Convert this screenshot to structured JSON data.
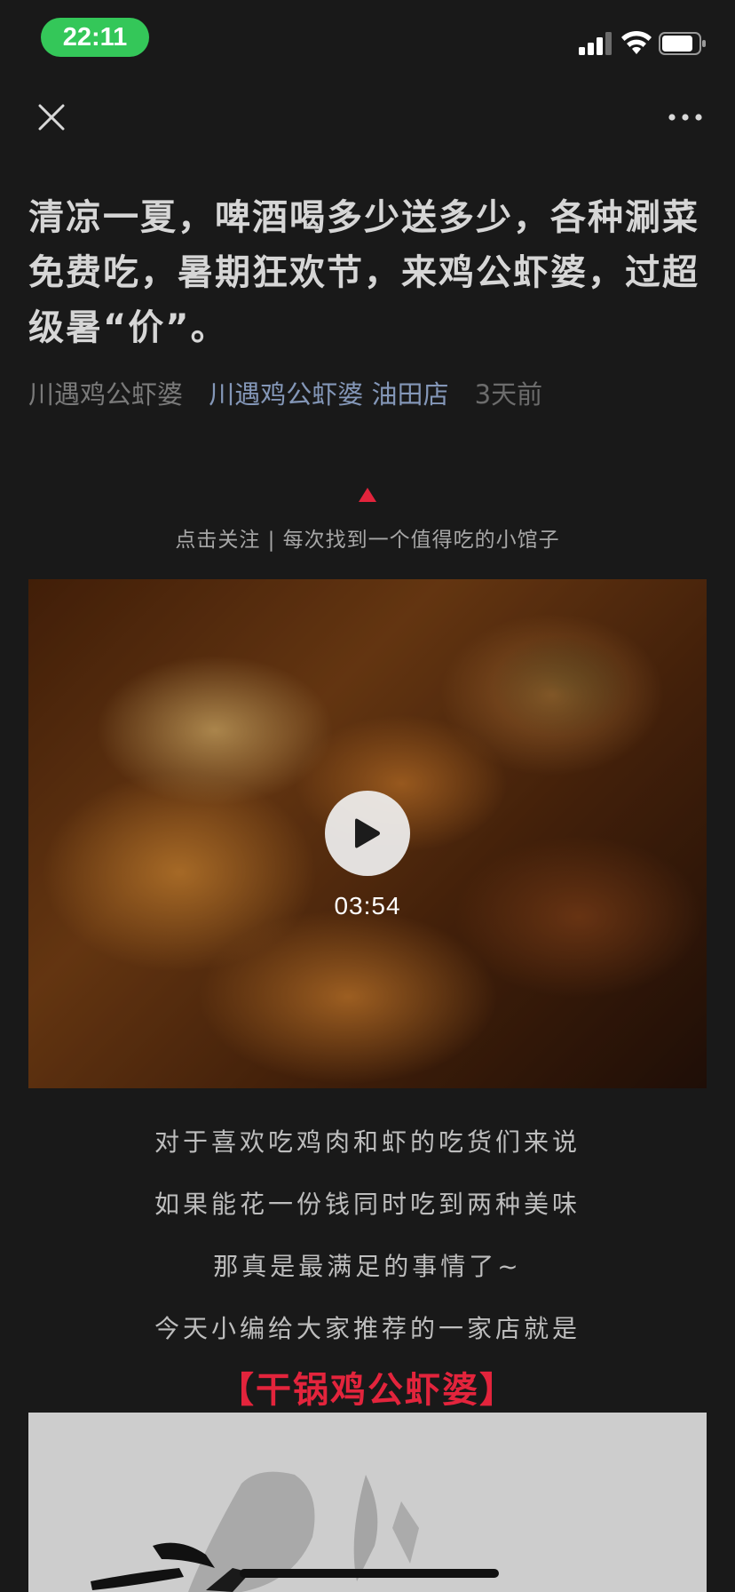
{
  "status_bar": {
    "time": "22:11",
    "time_pill_color": "#34c759",
    "icons": [
      "signal-icon",
      "wifi-icon",
      "battery-icon"
    ]
  },
  "nav": {
    "close_icon": "close-icon",
    "more_icon": "more-icon"
  },
  "article": {
    "title": "清凉一夏，啤酒喝多少送多少，各种涮菜免费吃，暑期狂欢节，来鸡公虾婆，过超级暑“价”。",
    "author": "川遇鸡公虾婆",
    "account": "川遇鸡公虾婆 油田店",
    "date": "3天前",
    "follow_text": "点击关注 | 每次找到一个值得吃的小馆子"
  },
  "video": {
    "duration": "03:54",
    "play_icon": "play-icon"
  },
  "body": {
    "paragraphs": [
      "对于喜欢吃鸡肉和虾的吃货们来说",
      "如果能花一份钱同时吃到两种美味",
      "那真是最满足的事情了~",
      "今天小编给大家推荐的一家店就是"
    ],
    "highlight": "【干锅鸡公虾婆】"
  },
  "colors": {
    "background": "#191919",
    "title": "#d6d6d6",
    "account_link": "#8497b8",
    "highlight": "#e3243c",
    "follow_arrow": "#e3243c"
  }
}
